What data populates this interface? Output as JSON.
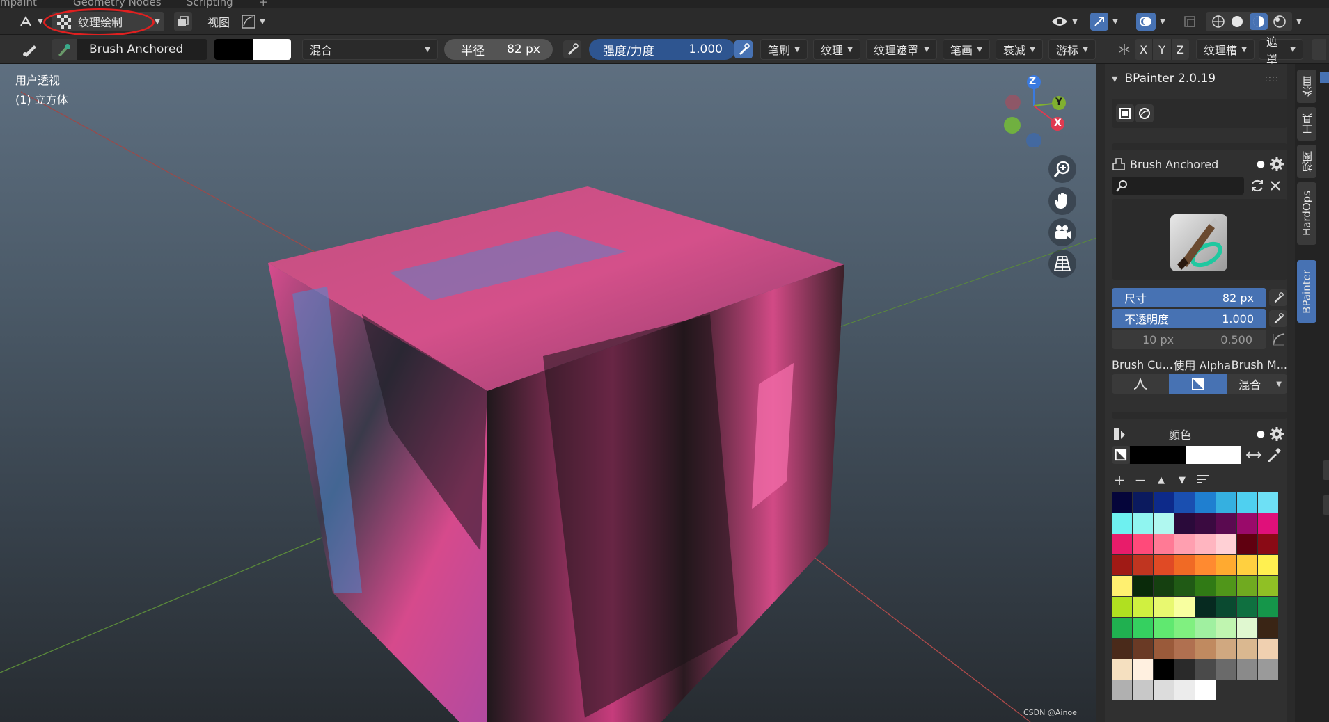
{
  "workspace_tabs": [
    "mpaint",
    "Geometry Nodes",
    "Scripting",
    "+"
  ],
  "header": {
    "mode_label": "纹理绘制",
    "view_label": "视图"
  },
  "toolrow": {
    "brush_name": "Brush Anchored",
    "blend_mode": "混合",
    "radius_label": "半径",
    "radius_value": "82 px",
    "strength_label": "强度/力度",
    "strength_value": "1.000",
    "menus": [
      "笔刷",
      "纹理",
      "纹理遮罩",
      "笔画",
      "衰减",
      "游标"
    ],
    "axis_x": "X",
    "axis_y": "Y",
    "axis_z": "Z",
    "slot_menu": "纹理槽",
    "mask_menu": "遮罩"
  },
  "viewport": {
    "view_name": "用户透视",
    "object_name": "(1) 立方体",
    "gizmo_x": "X",
    "gizmo_y": "Y",
    "gizmo_z": "Z",
    "watermark": "CSDN @Ainoe"
  },
  "panel": {
    "addon_title": "BPainter 2.0.19",
    "brush_name": "Brush Anchored",
    "size_label": "尺寸",
    "size_value": "82 px",
    "opacity_label": "不透明度",
    "opacity_value": "1.000",
    "secondary_size": "10 px",
    "secondary_opacity": "0.500",
    "curve_label": "Brush Cu...",
    "use_alpha_label": "使用 Alpha",
    "brush_mode_label": "Brush M...",
    "blend_label": "混合",
    "color_label": "颜色",
    "palette": [
      "#05053a",
      "#0b1a5e",
      "#0d2a8a",
      "#1a4fb0",
      "#1f7fd0",
      "#35b0e0",
      "#4fd0f0",
      "#6ee0f5",
      "#6ef0f0",
      "#90f5f0",
      "#b0f8f0",
      "#2a0a3a",
      "#3a0a40",
      "#5a0a50",
      "#9a0a6a",
      "#e0107a",
      "#e81c6a",
      "#ff4a7a",
      "#ff7a95",
      "#ff9fb0",
      "#ffb5c0",
      "#ffd0d5",
      "#600010",
      "#8a0a15",
      "#a01a15",
      "#c03520",
      "#e04a25",
      "#f06a25",
      "#ff8a30",
      "#ffaa30",
      "#ffd040",
      "#fff050",
      "#fff070",
      "#0a2a0a",
      "#154010",
      "#205a15",
      "#307a15",
      "#50961a",
      "#70aa20",
      "#90c025",
      "#b0e020",
      "#d0f040",
      "#e8f870",
      "#f8ffa0",
      "#062a20",
      "#0a4a30",
      "#0f7040",
      "#15964a",
      "#20b050",
      "#35d060",
      "#60e870",
      "#80f080",
      "#a0f0a0",
      "#c0f5b0",
      "#e0f8d0",
      "#3a2515",
      "#4a2a1a",
      "#6a3a25",
      "#9a5a3a",
      "#b07050",
      "#c08a60",
      "#d0a880",
      "#dab890",
      "#f0d0b0",
      "#f5e0c0",
      "#fff0e0",
      "#000000",
      "#2a2a2a",
      "#4a4a4a",
      "#6a6a6a",
      "#8a8a8a",
      "#9a9a9a",
      "#b0b0b0",
      "#c8c8c8",
      "#dcdcdc",
      "#ececec",
      "#ffffff"
    ]
  },
  "vtabs": [
    "条目",
    "工具",
    "视图",
    "HardOps",
    "BPainter"
  ]
}
